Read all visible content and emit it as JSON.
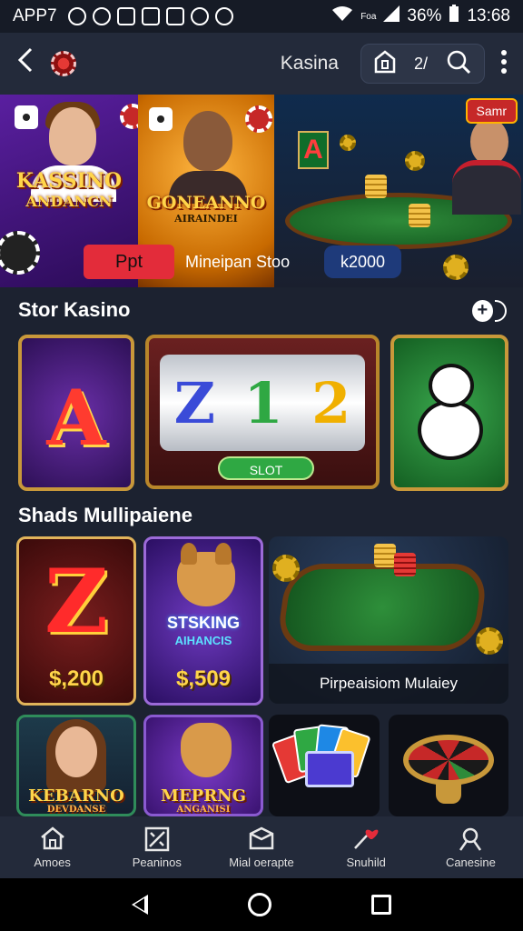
{
  "status_bar": {
    "app_label": "APP7",
    "carrier": "Foa",
    "battery": "36%",
    "time": "13:68"
  },
  "header": {
    "title": "Kasina",
    "coin_count": "2/"
  },
  "banner": {
    "panel_a_title": "KASSINO",
    "panel_a_subtitle": "ANDANCN",
    "panel_b_title": "GONEANNO",
    "panel_b_subtitle": "AIRAINDEI",
    "tag_label": "Samr",
    "promo_button": "Ppt",
    "promo_text": "Mineipan Stoo",
    "promo_amount": "k2000"
  },
  "section_1": {
    "title": "Stor Kasino",
    "slot_button": "SLOT",
    "tile_a_letter": "A",
    "reels": [
      "Z",
      "1",
      "2"
    ]
  },
  "section_2": {
    "title": "Shads Mullipaiene",
    "tile_seven": {
      "symbol": "Z",
      "price": "$,200"
    },
    "tile_dog": {
      "title": "STSKING",
      "subtitle": "AIHANCIS",
      "price": "$,509"
    },
    "tile_poker": {
      "caption": "Pirpeaisiom Mulaiey"
    },
    "tile_girl": {
      "title": "KEBARNO",
      "subtitle": "DEVDANSE"
    },
    "tile_dog2": {
      "title": "MEPRNG",
      "subtitle": "ANGANISI"
    }
  },
  "bottom_nav": [
    {
      "label": "Amoes",
      "icon": "home-icon"
    },
    {
      "label": "Peaninos",
      "icon": "grid-icon"
    },
    {
      "label": "Mial oerapte",
      "icon": "box-icon"
    },
    {
      "label": "Snuhild",
      "icon": "heart-pin-icon"
    },
    {
      "label": "Canesine",
      "icon": "user-icon"
    }
  ],
  "colors": {
    "background": "#1c2230",
    "header": "#232a3a",
    "accent_red": "#e32c3a",
    "gold": "#ffd54a"
  }
}
